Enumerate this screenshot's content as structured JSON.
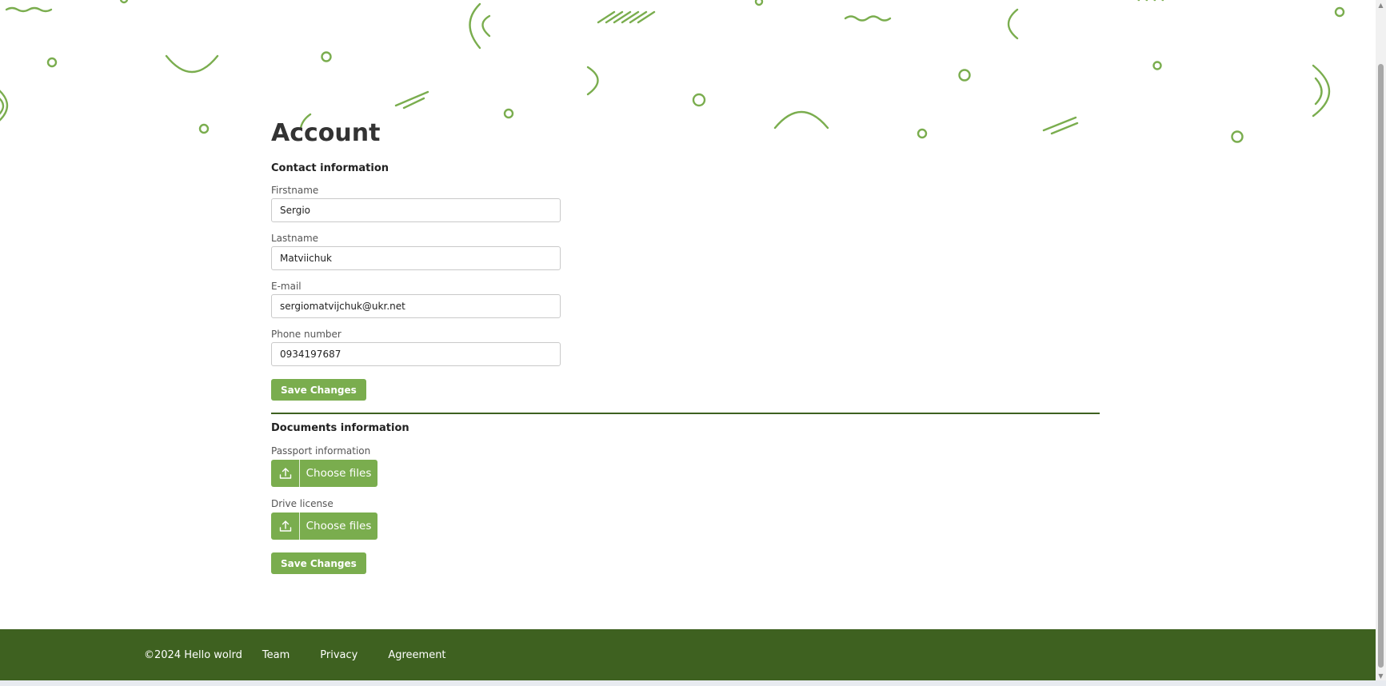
{
  "page": {
    "title": "Account"
  },
  "contact": {
    "section_title": "Contact information",
    "firstname_label": "Firstname",
    "firstname_value": "Sergio",
    "lastname_label": "Lastname",
    "lastname_value": "Matviichuk",
    "email_label": "E-mail",
    "email_value": "sergiomatvijchuk@ukr.net",
    "phone_label": "Phone number",
    "phone_value": "0934197687",
    "save_label": "Save Changes"
  },
  "documents": {
    "section_title": "Documents information",
    "passport_label": "Passport information",
    "passport_button": "Choose files",
    "license_label": "Drive license",
    "license_button": "Choose files",
    "save_label": "Save Changes"
  },
  "footer": {
    "copyright": "©2024 Hello wolrd",
    "links": [
      "Team",
      "Privacy",
      "Agreement"
    ]
  },
  "colors": {
    "accent": "#7aad4e",
    "footer_bg": "#3e6120",
    "divider": "#3e6120"
  },
  "icons": {
    "upload": "upload-icon"
  }
}
